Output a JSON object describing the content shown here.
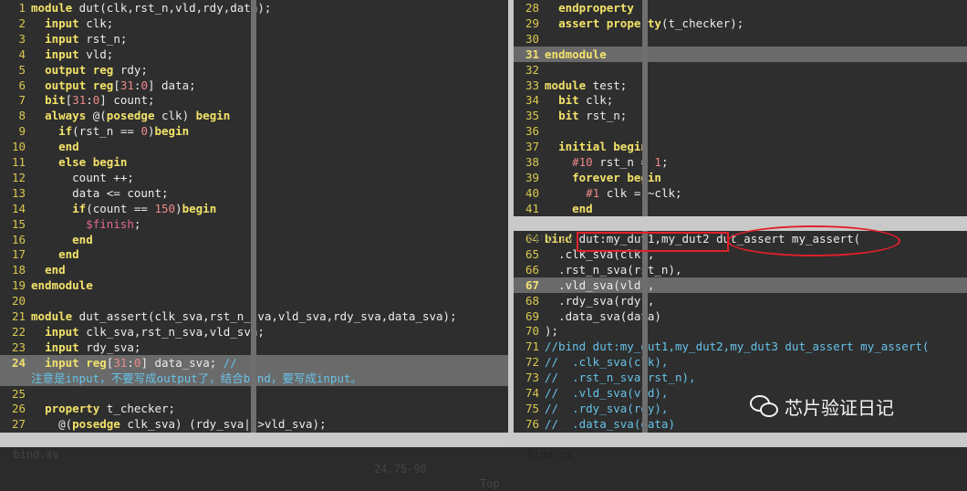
{
  "left_pane": {
    "lines": [
      {
        "n": "1",
        "html": "<span class='kw'>module</span> dut(clk,rst_n,vld,rdy,data);"
      },
      {
        "n": "2",
        "html": "  <span class='kw'>input</span> clk;"
      },
      {
        "n": "3",
        "html": "  <span class='kw'>input</span> rst_n;"
      },
      {
        "n": "4",
        "html": "  <span class='kw'>input</span> vld;"
      },
      {
        "n": "5",
        "html": "  <span class='kw'>output</span> <span class='ty'>reg</span> rdy;"
      },
      {
        "n": "6",
        "html": "  <span class='kw'>output</span> <span class='ty'>reg</span>[<span class='num'>31</span>:<span class='num'>0</span>] data;"
      },
      {
        "n": "7",
        "html": "  <span class='ty'>bit</span>[<span class='num'>31</span>:<span class='num'>0</span>] count;"
      },
      {
        "n": "8",
        "html": "  <span class='kw'>always</span> @(<span class='kw'>posedge</span> clk) <span class='kw'>begin</span>"
      },
      {
        "n": "9",
        "html": "    <span class='kw'>if</span>(rst_n == <span class='num'>0</span>)<span class='kw'>begin</span>"
      },
      {
        "n": "10",
        "html": "    <span class='kw'>end</span>"
      },
      {
        "n": "11",
        "html": "    <span class='kw'>else</span> <span class='kw'>begin</span>"
      },
      {
        "n": "12",
        "html": "      count ++;"
      },
      {
        "n": "13",
        "html": "      data <= count;"
      },
      {
        "n": "14",
        "html": "      <span class='kw'>if</span>(count == <span class='num'>150</span>)<span class='kw'>begin</span>"
      },
      {
        "n": "15",
        "html": "        <span class='sys'>$finish</span>;"
      },
      {
        "n": "16",
        "html": "      <span class='kw'>end</span>"
      },
      {
        "n": "17",
        "html": "    <span class='kw'>end</span>"
      },
      {
        "n": "18",
        "html": "  <span class='kw'>end</span>"
      },
      {
        "n": "19",
        "html": "<span class='kw'>endmodule</span>"
      },
      {
        "n": "20",
        "html": ""
      },
      {
        "n": "21",
        "html": "<span class='kw'>module</span> dut_assert(clk_sva,rst_n_sva,vld_sva,rdy_sva,data_sva);"
      },
      {
        "n": "22",
        "html": "  <span class='kw'>input</span> clk_sva,rst_n_sva,vld_sva;"
      },
      {
        "n": "23",
        "html": "  <span class='kw'>input</span> rdy_sva;"
      },
      {
        "n": "24",
        "cur": true,
        "hl": true,
        "html": "  <span class='kw'>input</span> <span class='ty'>reg</span>[<span class='num'>31</span>:<span class='num'>0</span>] data_sva; <span class='cm'>//</span>"
      },
      {
        "n": "",
        "hl": true,
        "html": "<span class='cn'>注意是input，不要写成output了，结合bind，要写成input。</span>"
      },
      {
        "n": "25",
        "html": ""
      },
      {
        "n": "26",
        "html": "  <span class='kw'>property</span> t_checker;"
      },
      {
        "n": "27",
        "html": "    @(<span class='kw'>posedge</span> clk_sva) (rdy_sva|->vld_sva);"
      }
    ]
  },
  "right_top_pane": {
    "lines": [
      {
        "n": "28",
        "html": "  <span class='kw'>endproperty</span>"
      },
      {
        "n": "29",
        "html": "  <span class='kw'>assert</span> <span class='kw'>property</span>(t_checker);"
      },
      {
        "n": "30",
        "html": ""
      },
      {
        "n": "31",
        "cur": true,
        "hl": true,
        "html": "<span class='kw'>endmodule</span>"
      },
      {
        "n": "32",
        "html": ""
      },
      {
        "n": "33",
        "html": "<span class='kw'>module</span> test;"
      },
      {
        "n": "34",
        "html": "  <span class='ty'>bit</span> clk;"
      },
      {
        "n": "35",
        "html": "  <span class='ty'>bit</span> rst_n;"
      },
      {
        "n": "36",
        "html": ""
      },
      {
        "n": "37",
        "html": "  <span class='kw'>initial</span> <span class='kw'>begin</span>"
      },
      {
        "n": "38",
        "html": "    <span class='num'>#10</span> rst_n = <span class='num'>1</span>;"
      },
      {
        "n": "39",
        "html": "    <span class='kw'>forever</span> <span class='kw'>begin</span>"
      },
      {
        "n": "40",
        "html": "      <span class='num'>#1</span> clk = ~clk;"
      },
      {
        "n": "41",
        "html": "    <span class='kw'>end</span>"
      }
    ]
  },
  "right_bottom_pane": {
    "lines": [
      {
        "n": "64",
        "html": "<span class='kw'>bind</span> dut:my_dut1,my_dut2 dut_assert my_assert("
      },
      {
        "n": "65",
        "html": "  .clk_sva(clk),"
      },
      {
        "n": "66",
        "html": "  .rst_n_sva(rst_n),"
      },
      {
        "n": "67",
        "cur": true,
        "hl": true,
        "html": "  .vld_sva(vld),"
      },
      {
        "n": "68",
        "html": "  .rdy_sva(rdy),"
      },
      {
        "n": "69",
        "html": "  .data_sva(data)"
      },
      {
        "n": "70",
        "html": ");"
      },
      {
        "n": "71",
        "html": "<span class='cm'>//bind dut:my_dut1,my_dut2,my_dut3 dut_assert my_assert(</span>"
      },
      {
        "n": "72",
        "html": "<span class='cm'>//  .clk_sva(clk),</span>"
      },
      {
        "n": "73",
        "html": "<span class='cm'>//  .rst_n_sva(rst_n),</span>"
      },
      {
        "n": "74",
        "html": "<span class='cm'>//  .vld_sva(vld),</span>"
      },
      {
        "n": "75",
        "html": "<span class='cm'>//  .rdy_sva(rdy),</span>"
      },
      {
        "n": "76",
        "html": "<span class='cm'>//  .data_sva(data)</span>"
      }
    ]
  },
  "status": {
    "left_file": "bind.sv",
    "left_pos": "24,75-98",
    "left_scroll": "Top",
    "right_top_file": "bind.sv",
    "right_bottom_file": "bind.sv"
  },
  "watermark": "芯片验证日记"
}
